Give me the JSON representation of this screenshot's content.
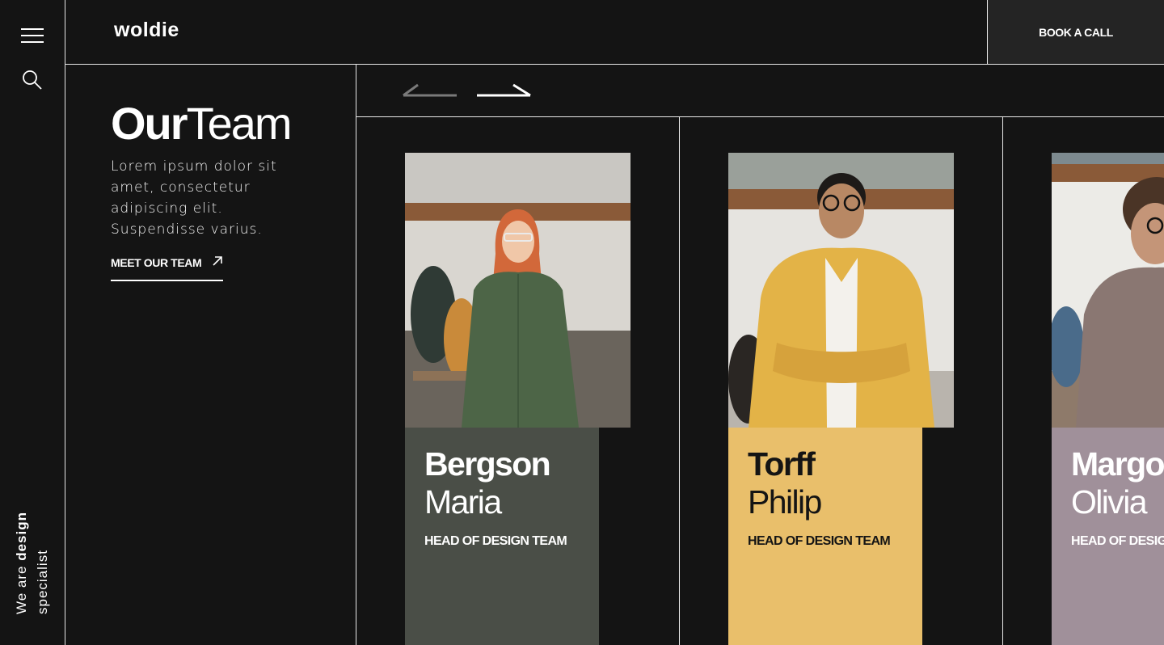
{
  "brand": {
    "logo": "woldie"
  },
  "header": {
    "cta_label": "BOOK A CALL"
  },
  "rail": {
    "tagline_prefix": "We are ",
    "tagline_bold": "design",
    "tagline_suffix": "specialist"
  },
  "intro": {
    "title_bold": "Our",
    "title_regular": "Team",
    "body": "Lorem ipsum dolor sit amet, consectetur adipiscing elit. Suspendisse varius.",
    "link_label": "MEET OUR TEAM"
  },
  "team": [
    {
      "surname": "Bergson",
      "first_name": "Maria",
      "role": "HEAD OF DESIGN TEAM",
      "color": "#4a4e47",
      "text_color": "#ffffff"
    },
    {
      "surname": "Torff",
      "first_name": "Philip",
      "role": "HEAD OF DESIGN TEAM",
      "color": "#e9bf6b",
      "text_color": "#141414"
    },
    {
      "surname": "Margo",
      "first_name": "Olivia",
      "role": "HEAD OF DESIGN TEAM",
      "color": "#a0909a",
      "text_color": "#ffffff"
    }
  ],
  "icons": {
    "menu": "hamburger-icon",
    "search": "search-icon",
    "link": "arrow-up-right-icon",
    "prev": "arrow-left-icon",
    "next": "arrow-right-icon"
  }
}
